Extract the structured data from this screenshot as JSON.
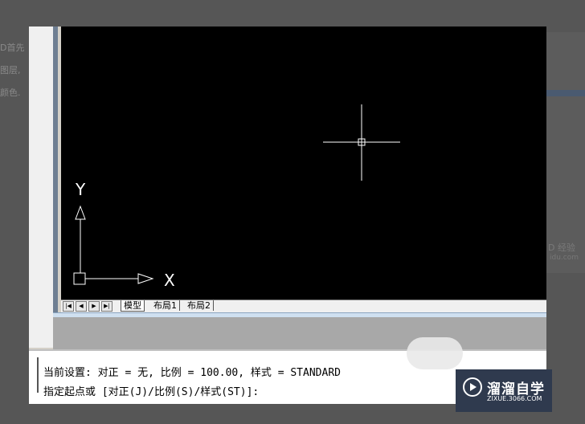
{
  "background_page": {
    "side_text": [
      "D首先",
      "图层,",
      "颜色."
    ],
    "watermark_top": "D 经验",
    "watermark_bottom": "idu.com"
  },
  "autocad": {
    "axis_labels": {
      "y": "Y",
      "x": "X"
    },
    "nav_buttons": [
      "|◀",
      "◀",
      "▶",
      "▶|"
    ],
    "tabs": [
      "模型",
      "布局1",
      "布局2"
    ],
    "active_tab": "模型",
    "command_lines": [
      "当前设置: 对正 = 无, 比例 = 100.00, 样式 = STANDARD",
      "指定起点或 [对正(J)/比例(S)/样式(ST)]:"
    ]
  },
  "logo": {
    "title": "溜溜自学",
    "url": "ZIXUE.3066.COM"
  },
  "colors": {
    "canvas": "#000000",
    "crosshair": "#ffffff",
    "logo_bg": "#2f3a4e"
  }
}
